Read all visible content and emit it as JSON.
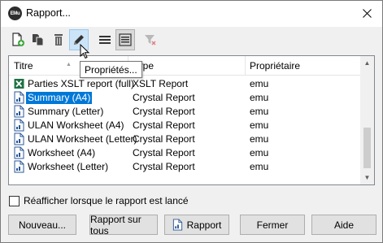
{
  "window": {
    "title": "Rapport...",
    "app_icon_text": "EMu"
  },
  "toolbar": {
    "buttons": [
      {
        "name": "new-report-icon"
      },
      {
        "name": "copy-report-icon"
      },
      {
        "name": "delete-report-icon"
      },
      {
        "name": "edit-properties-icon"
      },
      {
        "name": "list-view-icon"
      },
      {
        "name": "detail-view-icon"
      },
      {
        "name": "filter-clear-icon"
      }
    ],
    "tooltip": "Propriétés..."
  },
  "list": {
    "columns": [
      "Titre",
      "Type",
      "Propriétaire"
    ],
    "rows": [
      {
        "title": "Parties XSLT report (full)",
        "type": "XSLT Report",
        "owner": "emu",
        "icon": "xslt-icon"
      },
      {
        "title": "Summary (A4)",
        "type": "Crystal Report",
        "owner": "emu",
        "icon": "crystal-report-icon",
        "selected": true
      },
      {
        "title": "Summary (Letter)",
        "type": "Crystal Report",
        "owner": "emu",
        "icon": "crystal-report-icon"
      },
      {
        "title": "ULAN Worksheet (A4)",
        "type": "Crystal Report",
        "owner": "emu",
        "icon": "crystal-report-icon"
      },
      {
        "title": "ULAN Worksheet (Letter)",
        "type": "Crystal Report",
        "owner": "emu",
        "icon": "crystal-report-icon"
      },
      {
        "title": "Worksheet (A4)",
        "type": "Crystal Report",
        "owner": "emu",
        "icon": "crystal-report-icon"
      },
      {
        "title": "Worksheet (Letter)",
        "type": "Crystal Report",
        "owner": "emu",
        "icon": "crystal-report-icon"
      }
    ]
  },
  "options": {
    "redisplay_label": "Réafficher lorsque le rapport est lancé",
    "redisplay_checked": false
  },
  "buttons": {
    "new": "Nouveau...",
    "report_all": "Rapport sur tous",
    "report": "Rapport",
    "close": "Fermer",
    "help": "Aide"
  },
  "colors": {
    "selection": "#0078d7",
    "window_bg": "#f0f0f0"
  }
}
